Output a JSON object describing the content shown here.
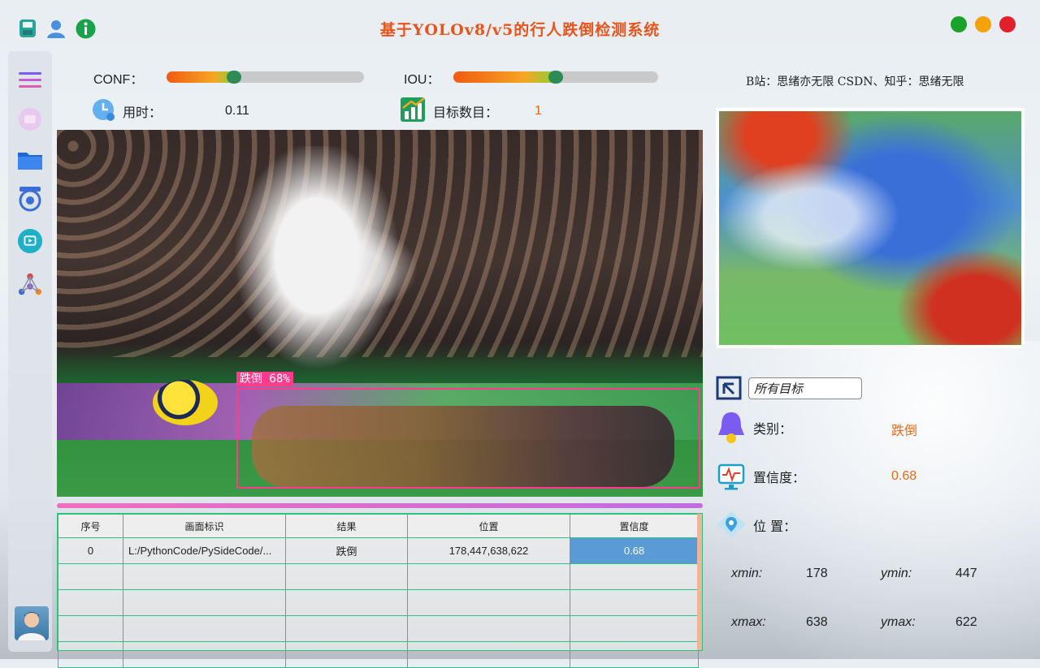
{
  "app": {
    "title": "基于YOLOv8/v5的行人跌倒检测系统"
  },
  "window_controls": {
    "minimize_color": "#1aa32b",
    "maximize_color": "#f5a10a",
    "close_color": "#e0202a"
  },
  "controls": {
    "conf": {
      "label": "CONF：",
      "value": 0.33
    },
    "iou": {
      "label": "IOU：",
      "value": 0.5
    }
  },
  "stats": {
    "time_label": "用时：",
    "time_value": "0.11",
    "count_label": "目标数目：",
    "count_value": "1"
  },
  "detection": {
    "label": "跌倒 68%",
    "color": "#ff3c8c"
  },
  "table": {
    "headers": [
      "序号",
      "画面标识",
      "结果",
      "位置",
      "置信度"
    ],
    "rows": [
      [
        "0",
        "L:/PythonCode/PySideCode/...",
        "跌倒",
        "178,447,638,622",
        "0.68"
      ]
    ]
  },
  "right": {
    "credit": "B站：思绪亦无限  CSDN、知乎：思绪无限",
    "target_select": "所有目标",
    "class_label": "类别：",
    "class_value": "跌倒",
    "conf_label": "置信度：",
    "conf_value": "0.68",
    "pos_label": "位 置：",
    "xmin_label": "xmin:",
    "xmin_value": "178",
    "ymin_label": "ymin:",
    "ymin_value": "447",
    "xmax_label": "xmax:",
    "xmax_value": "638",
    "ymax_label": "ymax:",
    "ymax_value": "622"
  },
  "icons": {
    "titlebar": [
      "save-icon",
      "user-icon",
      "info-icon"
    ],
    "sidebar": [
      "menu-icon",
      "image-icon",
      "folder-icon",
      "camera-icon",
      "video-icon",
      "model-icon"
    ]
  },
  "colors": {
    "accent": "#e8541c",
    "value_orange": "#e86a1a",
    "table_border": "#2ec27e",
    "selected_cell": "#5b9bd5"
  }
}
